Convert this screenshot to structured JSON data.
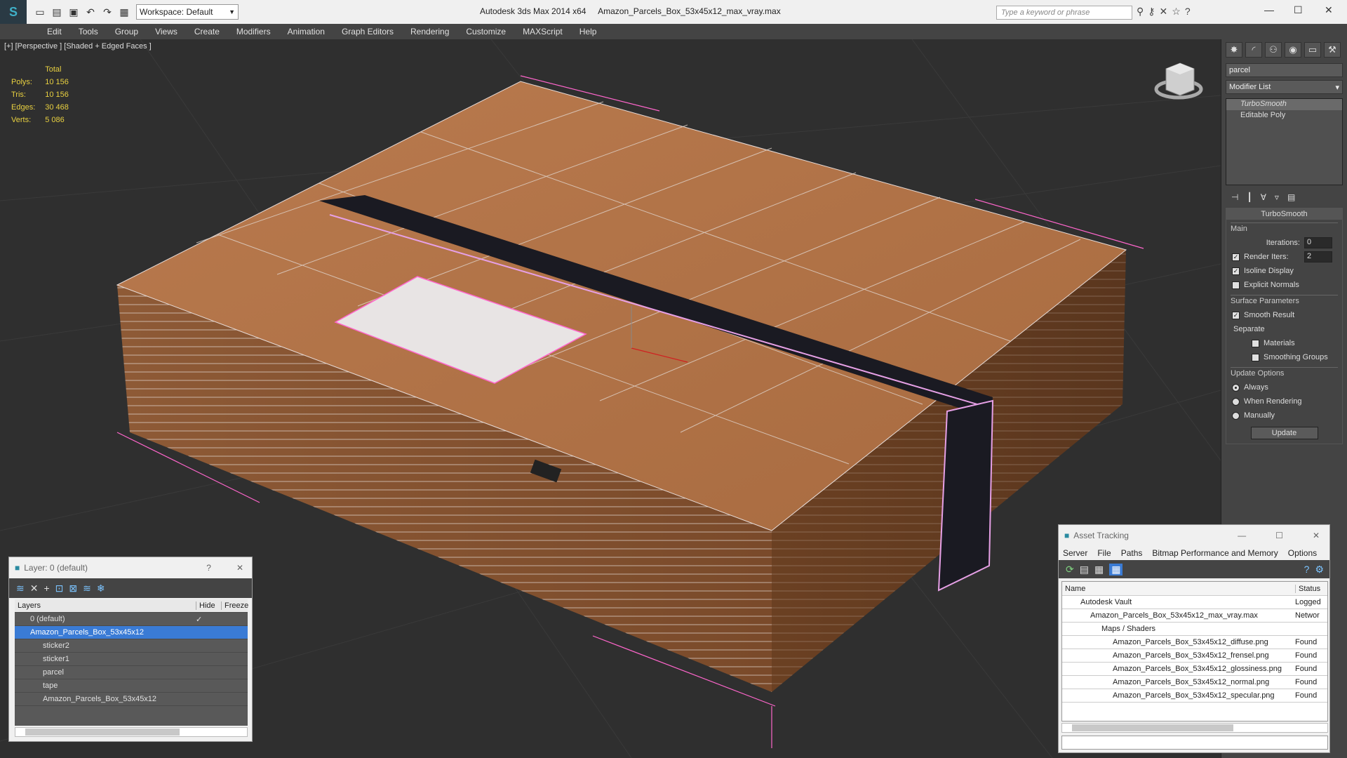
{
  "app": {
    "title": "Autodesk 3ds Max  2014 x64",
    "filename": "Amazon_Parcels_Box_53x45x12_max_vray.max",
    "workspace": "Workspace: Default",
    "search_placeholder": "Type a keyword or phrase"
  },
  "menu": [
    "Edit",
    "Tools",
    "Group",
    "Views",
    "Create",
    "Modifiers",
    "Animation",
    "Graph Editors",
    "Rendering",
    "Customize",
    "MAXScript",
    "Help"
  ],
  "viewport": {
    "label": "[+] [Perspective ] [Shaded + Edged Faces ]",
    "stats": {
      "total_label": "Total",
      "polys_label": "Polys:",
      "polys": "10 156",
      "tris_label": "Tris:",
      "tris": "10 156",
      "edges_label": "Edges:",
      "edges": "30 468",
      "verts_label": "Verts:",
      "verts": "5 086"
    }
  },
  "command_panel": {
    "object_name": "parcel",
    "modifier_list": "Modifier List",
    "stack": [
      "TurboSmooth",
      "Editable Poly"
    ],
    "rollout": "TurboSmooth",
    "main": "Main",
    "iterations_label": "Iterations:",
    "iterations": "0",
    "render_iters_label": "Render Iters:",
    "render_iters": "2",
    "isoline": "Isoline Display",
    "explicit_normals": "Explicit Normals",
    "surface_params": "Surface Parameters",
    "smooth_result": "Smooth Result",
    "separate": "Separate",
    "materials": "Materials",
    "smoothing_groups": "Smoothing Groups",
    "update_options": "Update Options",
    "always": "Always",
    "when_rendering": "When Rendering",
    "manually": "Manually",
    "update_button": "Update"
  },
  "layers": {
    "title": "Layer: 0 (default)",
    "help": "?",
    "col_layers": "Layers",
    "col_hide": "Hide",
    "col_freeze": "Freeze",
    "rows": [
      "0 (default)",
      "Amazon_Parcels_Box_53x45x12",
      "sticker2",
      "sticker1",
      "parcel",
      "tape",
      "Amazon_Parcels_Box_53x45x12"
    ]
  },
  "assets": {
    "title": "Asset Tracking",
    "menu": [
      "Server",
      "File",
      "Paths",
      "Bitmap Performance and Memory",
      "Options"
    ],
    "col_name": "Name",
    "col_status": "Status",
    "rows": [
      {
        "name": "Autodesk Vault",
        "status": "Logged"
      },
      {
        "name": "Amazon_Parcels_Box_53x45x12_max_vray.max",
        "status": "Networ"
      },
      {
        "name": "Maps / Shaders",
        "status": ""
      },
      {
        "name": "Amazon_Parcels_Box_53x45x12_diffuse.png",
        "status": "Found"
      },
      {
        "name": "Amazon_Parcels_Box_53x45x12_frensel.png",
        "status": "Found"
      },
      {
        "name": "Amazon_Parcels_Box_53x45x12_glossiness.png",
        "status": "Found"
      },
      {
        "name": "Amazon_Parcels_Box_53x45x12_normal.png",
        "status": "Found"
      },
      {
        "name": "Amazon_Parcels_Box_53x45x12_specular.png",
        "status": "Found"
      }
    ]
  }
}
